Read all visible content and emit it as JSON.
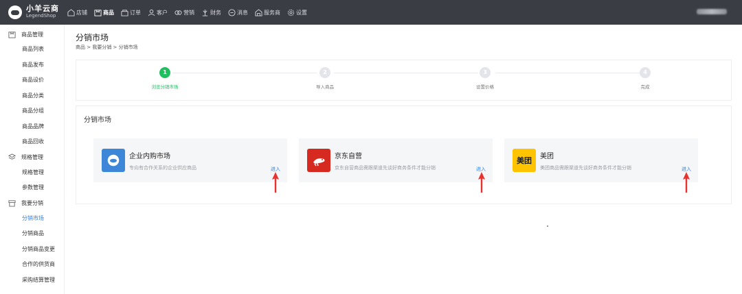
{
  "brand": {
    "name": "小羊云商",
    "subtitle": "LegendShop"
  },
  "nav": [
    {
      "label": "店铺",
      "icon": "shop-icon"
    },
    {
      "label": "商品",
      "icon": "product-icon",
      "active": true
    },
    {
      "label": "订单",
      "icon": "order-icon"
    },
    {
      "label": "客户",
      "icon": "customer-icon"
    },
    {
      "label": "营销",
      "icon": "marketing-icon"
    },
    {
      "label": "财务",
      "icon": "finance-icon"
    },
    {
      "label": "消息",
      "icon": "message-icon"
    },
    {
      "label": "服务商",
      "icon": "service-icon"
    },
    {
      "label": "设置",
      "icon": "settings-icon"
    }
  ],
  "sidebar": {
    "groups": [
      {
        "title": "商品管理",
        "icon": "product-icon",
        "items": [
          "商品列表",
          "商品发布",
          "商品设价",
          "商品分类",
          "商品分组",
          "商品品牌",
          "商品回收"
        ]
      },
      {
        "title": "规格管理",
        "icon": "spec-icon",
        "items": [
          "规格管理",
          "参数管理"
        ]
      },
      {
        "title": "我要分销",
        "icon": "store-icon",
        "items": [
          "分销市场",
          "分销商品",
          "分销商品变更",
          "合作的供货商",
          "采购结算管理"
        ]
      }
    ],
    "active_item": "分销市场"
  },
  "page": {
    "title": "分销市场",
    "breadcrumb": "商品 > 我要分销 > 分销市场"
  },
  "steps": [
    {
      "number": "1",
      "label": "浏览分销市场",
      "done": true
    },
    {
      "number": "2",
      "label": "导入商品",
      "done": false
    },
    {
      "number": "3",
      "label": "设置价格",
      "done": false
    },
    {
      "number": "4",
      "label": "完成",
      "done": false
    }
  ],
  "market": {
    "title": "分销市场",
    "channels": [
      {
        "name": "企业内购市场",
        "desc": "专向有合作关系的企业供应商品",
        "enter": "进入",
        "icon": "cloud-icon",
        "color": "#3e86d8"
      },
      {
        "name": "京东自营",
        "desc": "京东自营商品需跟渠道先谈好商务条件才能分销",
        "enter": "进入",
        "icon": "jd-dog-icon",
        "color": "#d62a20"
      },
      {
        "name": "美团",
        "desc": "美团商品需跟渠道先谈好商务条件才能分销",
        "enter": "进入",
        "icon": "meituan-icon",
        "icon_text": "美团",
        "color": "#ffc300"
      }
    ]
  },
  "colors": {
    "topbar": "#3b3d45",
    "accent": "#2f7fe6",
    "success": "#1fbe5f",
    "arrow": "#e8322f"
  }
}
